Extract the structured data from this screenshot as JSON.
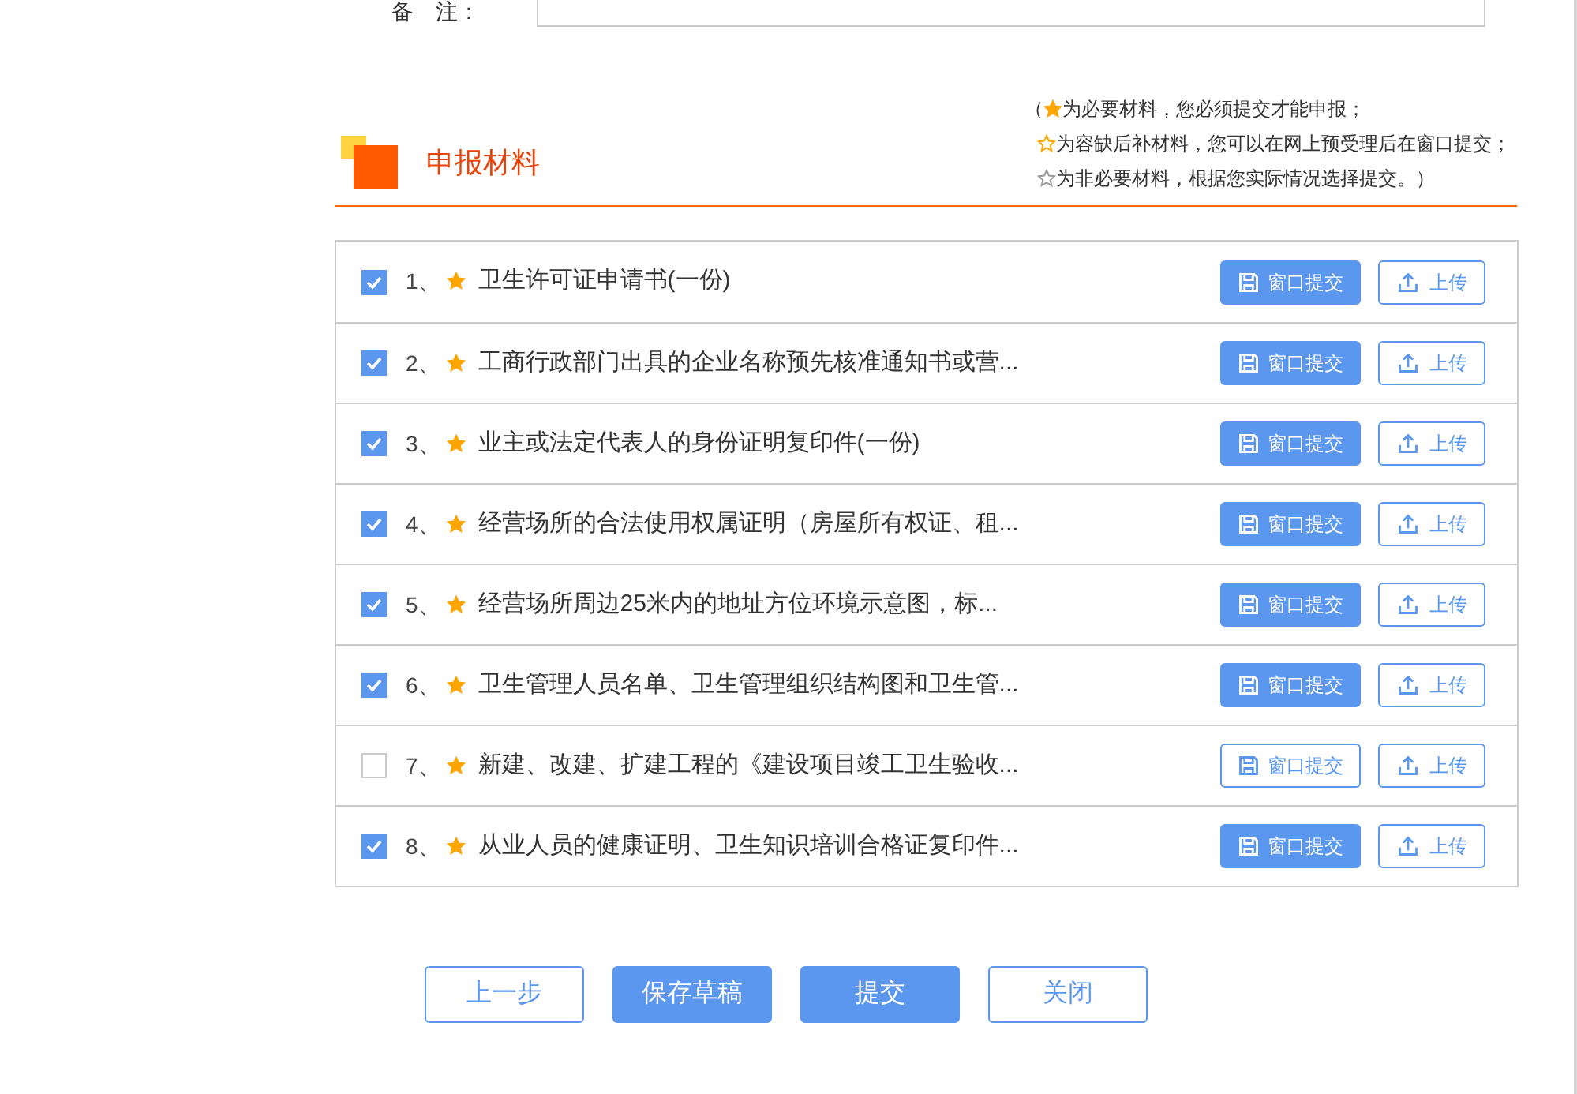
{
  "remarks": {
    "label": "备　注："
  },
  "section": {
    "title": "申报材料",
    "legend": [
      {
        "kind": "required",
        "prefix": "（",
        "text": "为必要材料，您必须提交才能申报；"
      },
      {
        "kind": "deferrable",
        "text": "为容缺后补材料，您可以在网上预受理后在窗口提交；"
      },
      {
        "kind": "optional",
        "text": "为非必要材料，根据您实际情况选择提交。）"
      }
    ]
  },
  "materials": [
    {
      "index": "1、",
      "name": "卫生许可证申请书(一份)",
      "checked": true,
      "window_submit": "窗口提交",
      "upload": "上传"
    },
    {
      "index": "2、",
      "name": "工商行政部门出具的企业名称预先核准通知书或营...",
      "checked": true,
      "window_submit": "窗口提交",
      "upload": "上传"
    },
    {
      "index": "3、",
      "name": "业主或法定代表人的身份证明复印件(一份)",
      "checked": true,
      "window_submit": "窗口提交",
      "upload": "上传"
    },
    {
      "index": "4、",
      "name": "经营场所的合法使用权属证明（房屋所有权证、租...",
      "checked": true,
      "window_submit": "窗口提交",
      "upload": "上传"
    },
    {
      "index": "5、",
      "name": "经营场所周边25米内的地址方位环境示意图，标...",
      "checked": true,
      "window_submit": "窗口提交",
      "upload": "上传"
    },
    {
      "index": "6、",
      "name": "卫生管理人员名单、卫生管理组织结构图和卫生管...",
      "checked": true,
      "window_submit": "窗口提交",
      "upload": "上传"
    },
    {
      "index": "7、",
      "name": "新建、改建、扩建工程的《建设项目竣工卫生验收...",
      "checked": false,
      "window_submit": "窗口提交",
      "upload": "上传"
    },
    {
      "index": "8、",
      "name": "从业人员的健康证明、卫生知识培训合格证复印件...",
      "checked": true,
      "window_submit": "窗口提交",
      "upload": "上传"
    }
  ],
  "actions": [
    {
      "label": "上一步",
      "primary": false
    },
    {
      "label": "保存草稿",
      "primary": true
    },
    {
      "label": "提交",
      "primary": true
    },
    {
      "label": "关闭",
      "primary": false
    }
  ]
}
